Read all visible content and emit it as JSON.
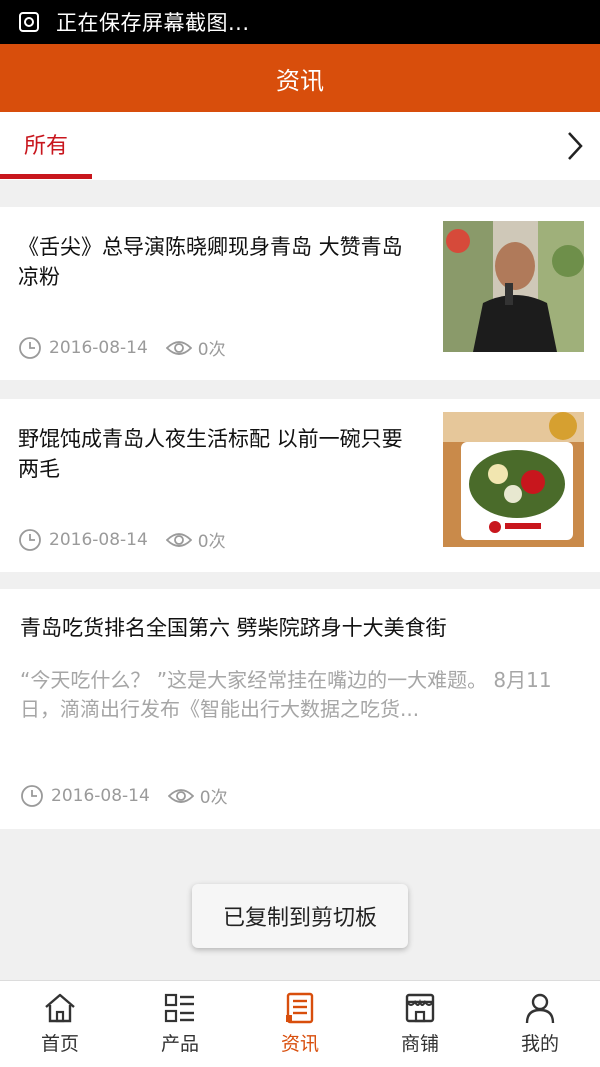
{
  "status_bar": {
    "text": "正在保存屏幕截图..."
  },
  "header": {
    "title": "资讯"
  },
  "tabs": {
    "active_label": "所有"
  },
  "articles": [
    {
      "title": "《舌尖》总导演陈晓卿现身青岛 大赞青岛凉粉",
      "date": "2016-08-14",
      "views": "0次",
      "has_image": true
    },
    {
      "title": "野馄饨成青岛人夜生活标配 以前一碗只要两毛",
      "date": "2016-08-14",
      "views": "0次",
      "has_image": true
    },
    {
      "title": "青岛吃货排名全国第六 劈柴院跻身十大美食街",
      "summary": "“今天吃什么？ ”这是大家经常挂在嘴边的一大难题。 8月11日，滴滴出行发布《智能出行大数据之吃货...",
      "date": "2016-08-14",
      "views": "0次",
      "has_image": false
    }
  ],
  "toast": {
    "text": "已复制到剪切板"
  },
  "bottom_nav": {
    "items": [
      {
        "label": "首页",
        "icon": "home-icon",
        "active": false
      },
      {
        "label": "产品",
        "icon": "grid-list-icon",
        "active": false
      },
      {
        "label": "资讯",
        "icon": "news-icon",
        "active": true
      },
      {
        "label": "商铺",
        "icon": "store-icon",
        "active": false
      },
      {
        "label": "我的",
        "icon": "user-icon",
        "active": false
      }
    ]
  },
  "colors": {
    "header_bg": "#d84e0c",
    "tab_active": "#c8161d",
    "nav_active": "#d84e0c"
  }
}
